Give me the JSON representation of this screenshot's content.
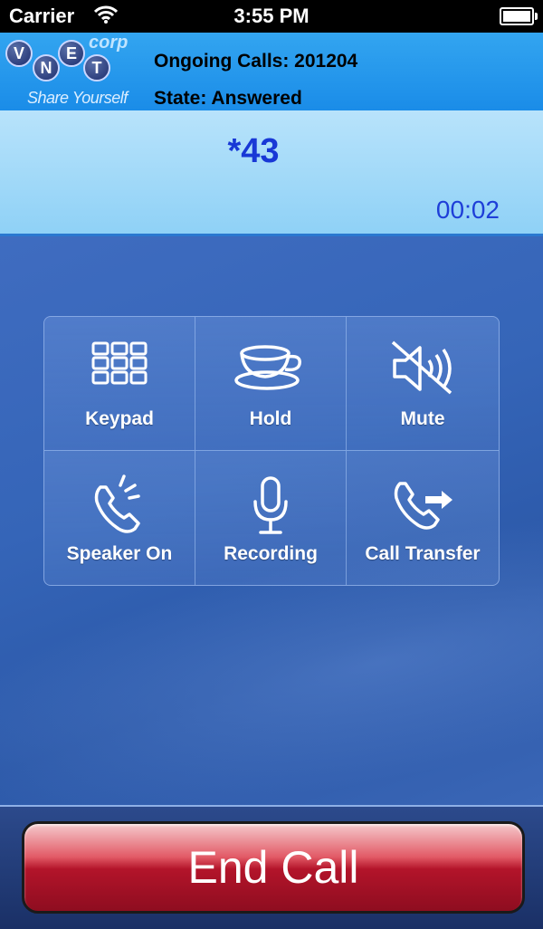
{
  "status_bar": {
    "carrier": "Carrier",
    "time": "3:55 PM"
  },
  "header": {
    "logo": {
      "letters": [
        "V",
        "N",
        "E",
        "T"
      ],
      "corp": "corp",
      "tagline": "Share Yourself"
    },
    "ongoing_calls": "Ongoing Calls: 201204",
    "state": "State: Answered"
  },
  "call": {
    "number": "*43",
    "timer": "00:02"
  },
  "controls": [
    {
      "label": "Keypad",
      "icon": "keypad-icon"
    },
    {
      "label": "Hold",
      "icon": "cup-icon"
    },
    {
      "label": "Mute",
      "icon": "speaker-muted-icon"
    },
    {
      "label": "Speaker On",
      "icon": "phone-speaker-icon"
    },
    {
      "label": "Recording",
      "icon": "microphone-icon"
    },
    {
      "label": "Call Transfer",
      "icon": "phone-transfer-icon"
    }
  ],
  "end_call": {
    "label": "End Call"
  },
  "colors": {
    "header": "#1a8ce8",
    "dial_bar": "#9fd8f8",
    "number": "#1838d6",
    "end_call": "#b3142a"
  }
}
